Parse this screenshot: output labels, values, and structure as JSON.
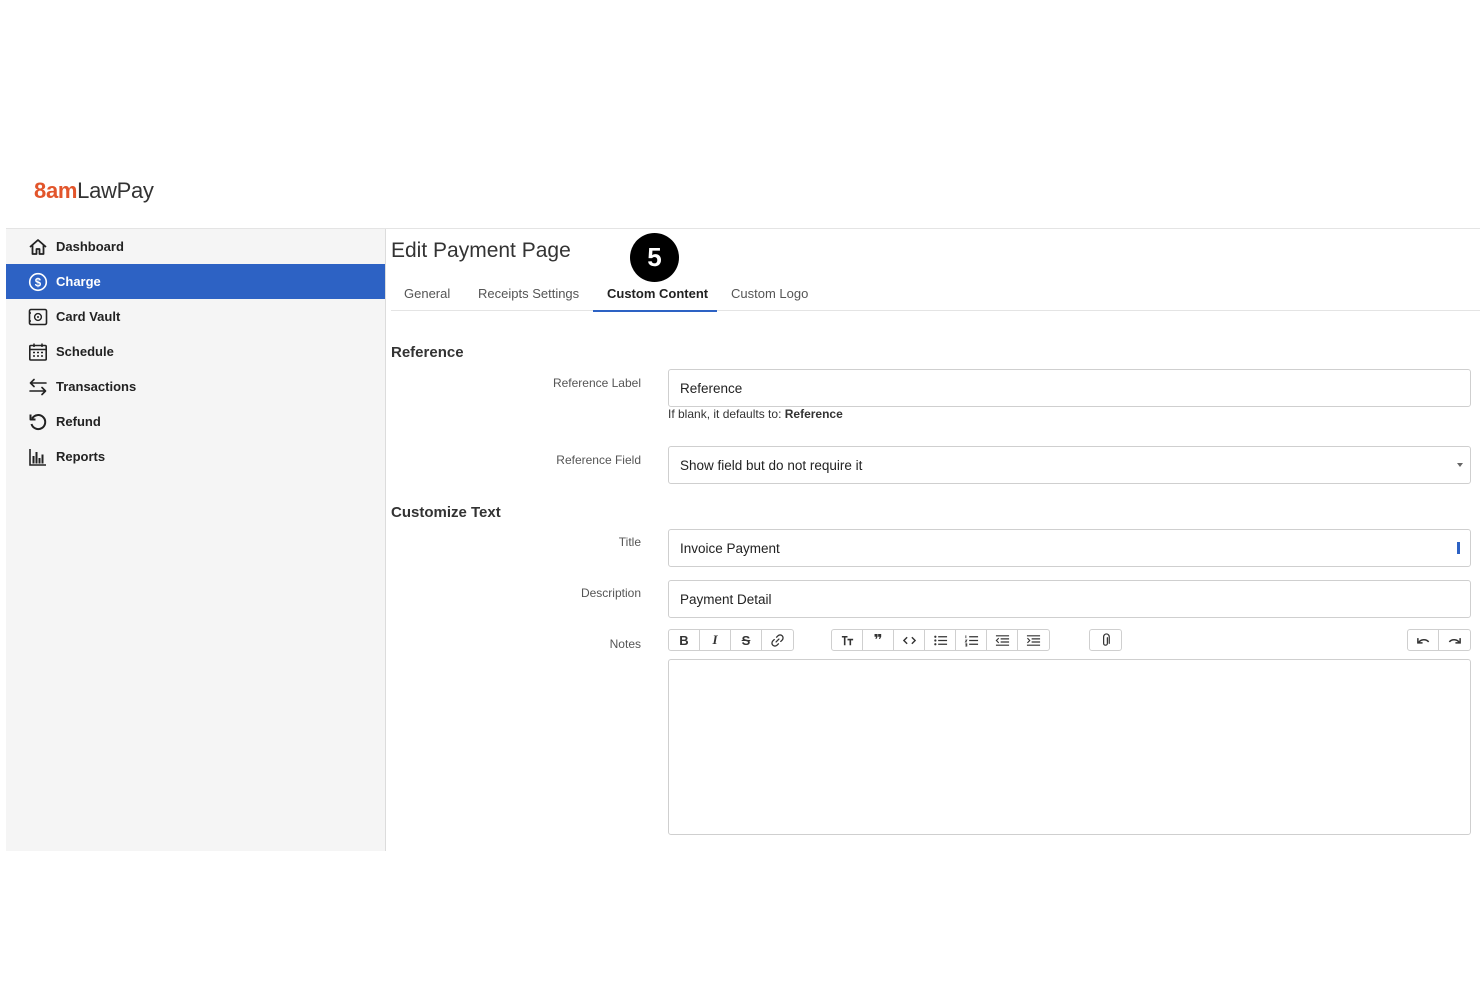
{
  "brand": {
    "part1": "am",
    "part1_prefix": "8",
    "part2": "LawPay",
    "accent": "#e2552b"
  },
  "sidebar": {
    "items": [
      {
        "label": "Dashboard",
        "icon": "home-icon"
      },
      {
        "label": "Charge",
        "icon": "dollar-circle-icon",
        "active": true
      },
      {
        "label": "Card Vault",
        "icon": "vault-icon"
      },
      {
        "label": "Schedule",
        "icon": "calendar-icon"
      },
      {
        "label": "Transactions",
        "icon": "transfer-arrows-icon"
      },
      {
        "label": "Refund",
        "icon": "refund-icon"
      },
      {
        "label": "Reports",
        "icon": "bar-chart-icon"
      }
    ],
    "active_color": "#2d62c4"
  },
  "main": {
    "title": "Edit Payment Page",
    "step_badge": "5",
    "tabs": [
      {
        "label": "General"
      },
      {
        "label": "Receipts Settings"
      },
      {
        "label": "Custom Content",
        "active": true
      },
      {
        "label": "Custom Logo"
      }
    ],
    "reference": {
      "section_title": "Reference",
      "label_label": "Reference Label",
      "label_value": "Reference",
      "help_prefix": "If blank, it defaults to: ",
      "help_default": "Reference",
      "field_label": "Reference Field",
      "field_value": "Show field but do not require it"
    },
    "customize": {
      "section_title": "Customize Text",
      "title_label": "Title",
      "title_value": "Invoice Payment",
      "description_label": "Description",
      "description_value": "Payment Detail",
      "notes_label": "Notes",
      "notes_value": ""
    },
    "toolbar": {
      "format": [
        "bold-icon",
        "italic-icon",
        "strikethrough-icon",
        "link-icon"
      ],
      "block": [
        "heading-icon",
        "quote-icon",
        "code-icon",
        "bullet-list-icon",
        "numbered-list-icon",
        "outdent-icon",
        "indent-icon"
      ],
      "attach": [
        "attach-icon"
      ],
      "history": [
        "undo-icon",
        "redo-icon"
      ]
    }
  }
}
